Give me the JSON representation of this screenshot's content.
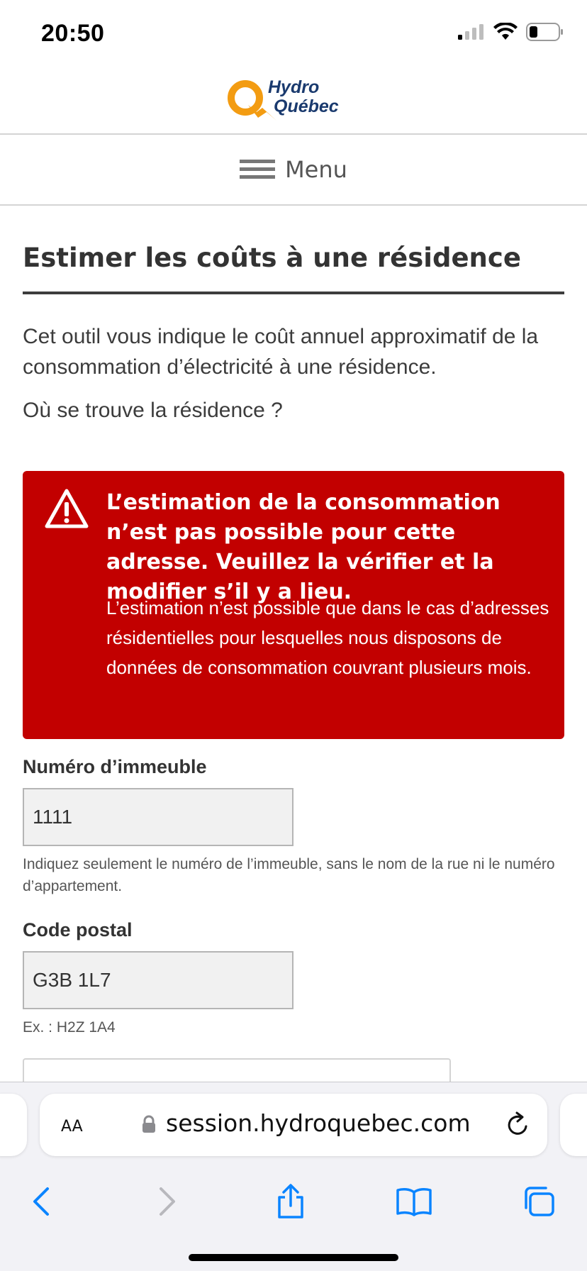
{
  "status_bar": {
    "time": "20:50"
  },
  "header": {
    "logo_line1": "Hydro",
    "logo_line2": "Québec",
    "menu_label": "Menu"
  },
  "page": {
    "title": "Estimer les coûts à une résidence",
    "intro": "Cet outil vous indique le coût annuel approximatif de la consommation d’électricité à une résidence.",
    "question": "Où se trouve la résidence ?"
  },
  "alert": {
    "title": "L’estimation de la consommation n’est pas possible pour cette adresse. Veuillez la vérifier et la modifier s’il y a lieu.",
    "body": "L’estimation n’est possible que dans le cas d’adresses résidentielles pour lesquelles nous disposons de données de consommation couvrant plusieurs mois.",
    "color": "#c20000"
  },
  "form": {
    "building": {
      "label": "Numéro d’immeuble",
      "value": "1111",
      "help": "Indiquez seulement le numéro de l’immeuble, sans le nom de la rue ni le numéro d’appartement."
    },
    "postal": {
      "label": "Code postal",
      "value": "G3B 1L7",
      "help": "Ex. : H2Z 1A4"
    }
  },
  "browser": {
    "text_size_button": "AA",
    "url": "session.hydroquebec.com",
    "icons": [
      "lock-icon",
      "reload-icon",
      "back-icon",
      "forward-icon",
      "share-icon",
      "bookmarks-icon",
      "tabs-icon"
    ],
    "accent": "#0a84ff"
  }
}
